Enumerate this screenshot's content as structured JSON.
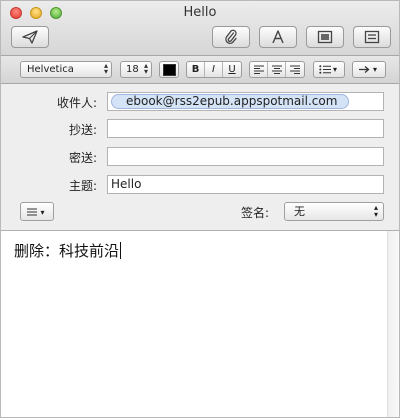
{
  "window": {
    "title": "Hello"
  },
  "toolbar": {
    "send_icon": "send-paper-plane-icon",
    "attach_icon": "paperclip-icon",
    "fonts_icon": "fonts-A-icon",
    "photo_icon": "photo-browser-icon",
    "template_icon": "stationery-template-icon"
  },
  "formatbar": {
    "font_family": "Helvetica",
    "font_size": "18",
    "text_color": "#000000",
    "bold": "B",
    "italic": "I",
    "underline": "U",
    "align_icons": [
      "align-left-icon",
      "align-center-icon",
      "align-right-icon"
    ],
    "list_icon": "bulleted-list-icon",
    "indent_icon": "indent-arrow-icon"
  },
  "headers": {
    "to_label": "收件人:",
    "to_recipient": "ebook@rss2epub.appspotmail.com",
    "cc_label": "抄送:",
    "cc_value": "",
    "bcc_label": "密送:",
    "bcc_value": "",
    "subject_label": "主题:",
    "subject_value": "Hello",
    "signature_label": "签名:",
    "signature_value": "无"
  },
  "body": {
    "text": "删除：科技前沿"
  }
}
